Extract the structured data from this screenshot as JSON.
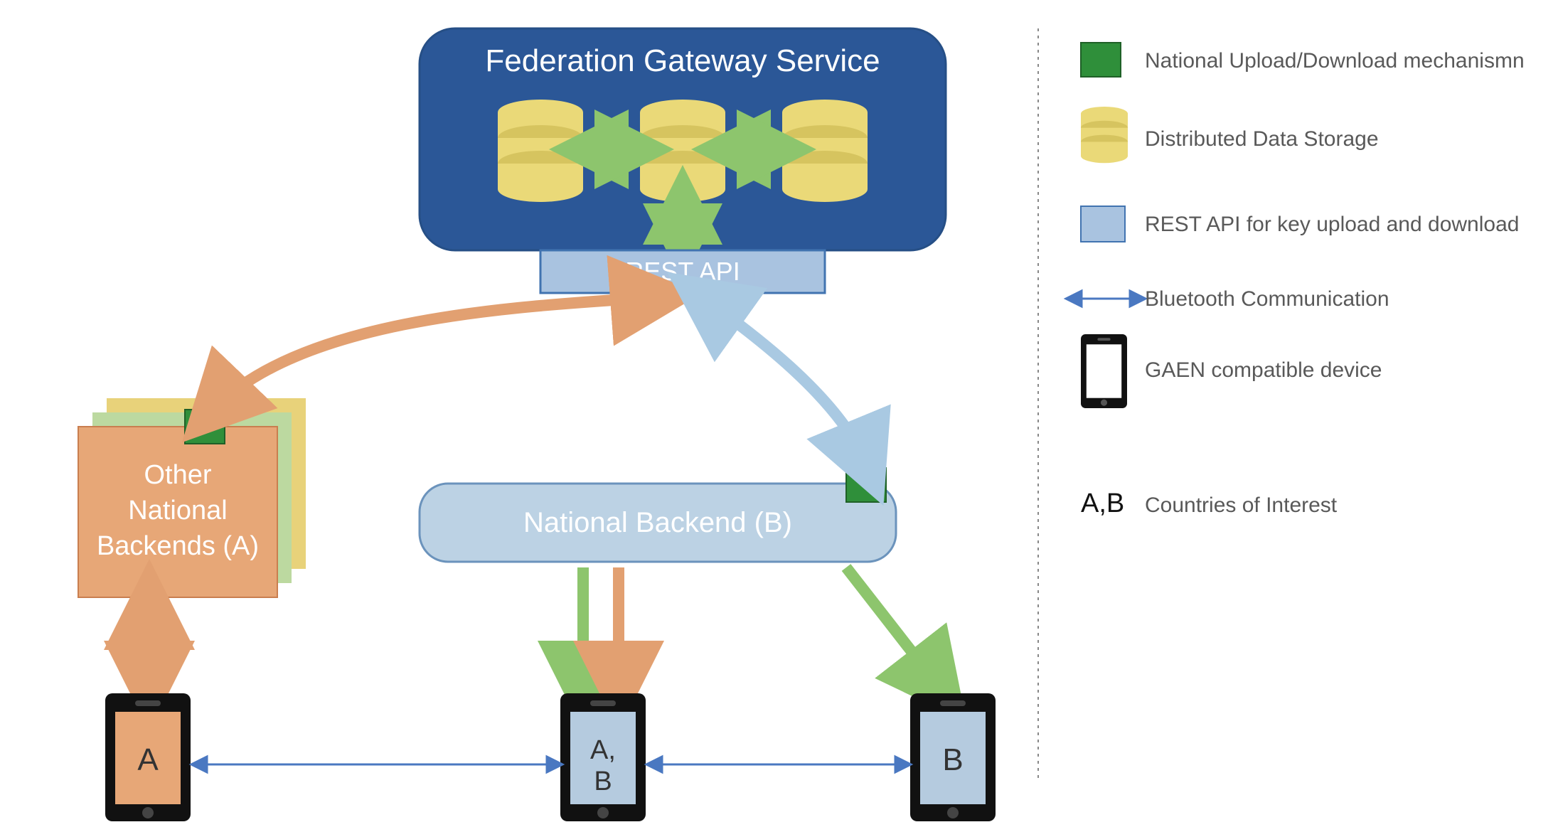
{
  "gateway": {
    "title": "Federation Gateway Service",
    "rest_api_label": "REST API"
  },
  "other_backends": {
    "label_line1": "Other",
    "label_line2": "National",
    "label_line3": "Backends (A)"
  },
  "national_backend_b": {
    "label": "National Backend (B)"
  },
  "phones": {
    "a_label": "A",
    "ab_label_line1": "A,",
    "ab_label_line2": "B",
    "b_label": "B"
  },
  "legend": {
    "upload_download": "National Upload/Download mechanismn",
    "storage": "Distributed Data Storage",
    "rest_api": "REST API for key upload and download",
    "bluetooth": "Bluetooth Communication",
    "device": "GAEN compatible device",
    "countries_symbol": "A,B",
    "countries": "Countries of Interest"
  },
  "colors": {
    "blue_panel": "#2b5797",
    "blue_panel_dark": "#264f86",
    "db_yellow": "#ead978",
    "rest_box": "#a9c3e0",
    "rest_border": "#4173b0",
    "green_box": "#2f8f3a",
    "green_arrow": "#8dc56d",
    "orange_box": "#e7a777",
    "orange_arrow": "#e2a071",
    "light_blue_box": "#bcd2e4",
    "light_blue_border": "#6b93bc",
    "light_blue_arrow": "#a9c9e2",
    "phone_black": "#111111",
    "phone_screen_orange": "#e7a777",
    "phone_screen_blue": "#b5cbdf",
    "bt_blue": "#4a78c1",
    "text_gray": "#595959",
    "backend_green": "#bcd9a0",
    "backend_yellow": "#e8d27a"
  }
}
